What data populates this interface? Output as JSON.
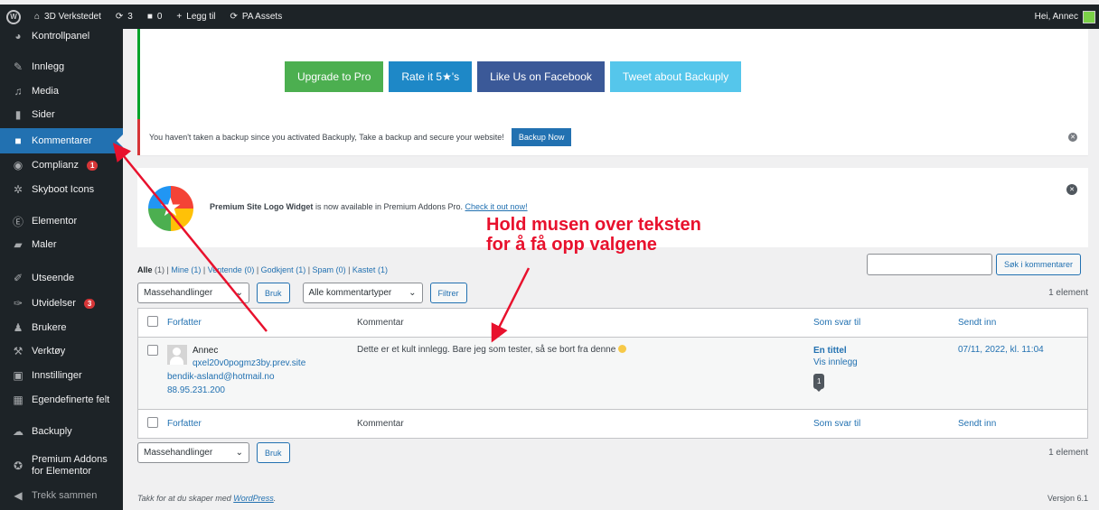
{
  "adminbar": {
    "site_name": "3D Verkstedet",
    "updates_count": "3",
    "comments_count": "0",
    "new_label": "Legg til",
    "pa_assets": "PA Assets",
    "greeting": "Hei, Annec"
  },
  "sidebar": {
    "items": [
      {
        "label": "Kontrollpanel",
        "icon": "dashboard-icon"
      },
      {
        "label": "Innlegg",
        "icon": "pin-icon"
      },
      {
        "label": "Media",
        "icon": "media-icon"
      },
      {
        "label": "Sider",
        "icon": "pages-icon"
      },
      {
        "label": "Kommentarer",
        "icon": "comments-icon"
      },
      {
        "label": "Complianz",
        "icon": "complianz-icon",
        "badge": "1"
      },
      {
        "label": "Skyboot Icons",
        "icon": "gear-icon"
      },
      {
        "label": "Elementor",
        "icon": "elementor-icon"
      },
      {
        "label": "Maler",
        "icon": "folder-icon"
      },
      {
        "label": "Utseende",
        "icon": "brush-icon"
      },
      {
        "label": "Utvidelser",
        "icon": "plugin-icon",
        "badge": "3"
      },
      {
        "label": "Brukere",
        "icon": "users-icon"
      },
      {
        "label": "Verktøy",
        "icon": "wrench-icon"
      },
      {
        "label": "Innstillinger",
        "icon": "settings-icon"
      },
      {
        "label": "Egendefinerte felt",
        "icon": "grid-icon"
      },
      {
        "label": "Backuply",
        "icon": "cloud-icon"
      },
      {
        "label": "Premium Addons",
        "label2": "for Elementor",
        "icon": "star-icon"
      },
      {
        "label": "Trekk sammen",
        "icon": "collapse-icon"
      }
    ]
  },
  "promo": {
    "upgrade": "Upgrade to Pro",
    "rate": "Rate it 5★'s",
    "facebook": "Like Us on Facebook",
    "tweet": "Tweet about Backuply"
  },
  "notice": {
    "text": "You haven't taken a backup since you activated Backuply, Take a backup and secure your website!",
    "button": "Backup Now"
  },
  "premium": {
    "bold": "Premium Site Logo Widget",
    "text": " is now available in Premium Addons Pro. ",
    "link": "Check it out now!"
  },
  "annotation": {
    "line1": "Hold musen over teksten",
    "line2": "for å få opp valgene",
    "color": "#e8112d"
  },
  "filters": {
    "all": "Alle",
    "all_count": "(1)",
    "mine": "Mine",
    "mine_count": "(1)",
    "pending": "Ventende",
    "pending_count": "(0)",
    "approved": "Godkjent",
    "approved_count": "(1)",
    "spam": "Spam",
    "spam_count": "(0)",
    "trash": "Kastet",
    "trash_count": "(1)"
  },
  "search": {
    "button": "Søk i kommentarer",
    "value": ""
  },
  "tablenav": {
    "bulk": "Massehandlinger",
    "apply": "Bruk",
    "types": "Alle kommentartyper",
    "filter": "Filtrer",
    "count": "1 element"
  },
  "table": {
    "headers": {
      "author": "Forfatter",
      "comment": "Kommentar",
      "response": "Som svar til",
      "submitted": "Sendt inn"
    },
    "row": {
      "author": "Annec",
      "site": "qxel20v0pogmz3by.prev.site",
      "email": "bendik-asland@hotmail.no",
      "ip": "88.95.231.200",
      "comment": "Dette er et kult innlegg. Bare jeg som tester, så se bort fra denne",
      "response_title": "En tittel",
      "view_post": "Vis innlegg",
      "comment_count": "1",
      "date": "07/11, 2022, kl. 11:04"
    }
  },
  "footer": {
    "thanks": "Takk for at du skaper med ",
    "wordpress": "WordPress",
    "thanks_end": ".",
    "version": "Versjon 6.1"
  }
}
